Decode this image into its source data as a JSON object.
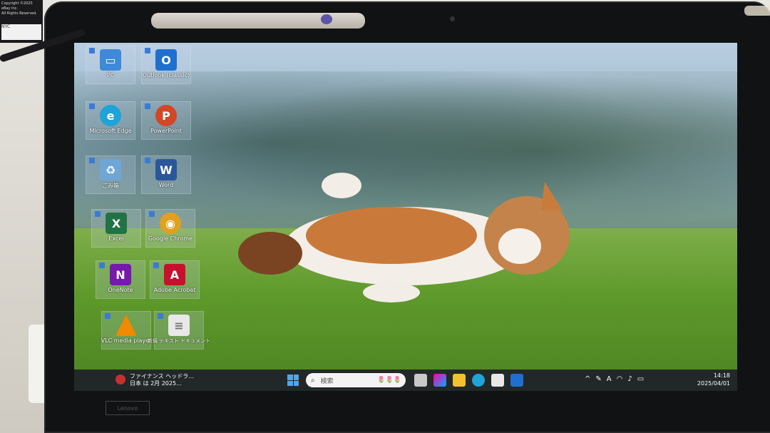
{
  "corner_device": {
    "line1": "Copyright ©2025 eBay Inc.",
    "line2": "All Rights Reserved.",
    "badge": "NYC"
  },
  "desktop_icons": [
    {
      "label": "PC",
      "icon": "pc-icon",
      "color": "#3f8ad8"
    },
    {
      "label": "Outlook (classic)",
      "icon": "outlook-icon",
      "color": "#1f6fd0"
    },
    {
      "label": "Microsoft Edge",
      "icon": "edge-icon",
      "color": "#1fa3d8"
    },
    {
      "label": "PowerPoint",
      "icon": "powerpoint-icon",
      "color": "#d24726"
    },
    {
      "label": "ごみ箱",
      "icon": "recycle-bin-icon",
      "color": "#6fa6d6"
    },
    {
      "label": "Word",
      "icon": "word-icon",
      "color": "#2b579a"
    },
    {
      "label": "Excel",
      "icon": "excel-icon",
      "color": "#217346"
    },
    {
      "label": "Google Chrome",
      "icon": "chrome-icon",
      "color": "#e0a020"
    },
    {
      "label": "OneNote",
      "icon": "onenote-icon",
      "color": "#7719aa"
    },
    {
      "label": "Adobe Acrobat",
      "icon": "acrobat-icon",
      "color": "#c8102e"
    },
    {
      "label": "VLC media player",
      "icon": "vlc-icon",
      "color": "#f08a00"
    },
    {
      "label": "新規 テキスト ドキュメント",
      "icon": "text-document-icon",
      "color": "#e8e8e8"
    }
  ],
  "taskbar": {
    "news_title": "ファイナンス ヘッドラ...",
    "news_sub": "日本 は 2月 2025...",
    "search_placeholder": "検索",
    "search_decoration": "🌷🌷🌷",
    "time": "14:18",
    "date": "2025/04/01",
    "tray_letter": "A"
  },
  "sticker": {
    "label": "Lenovo"
  }
}
